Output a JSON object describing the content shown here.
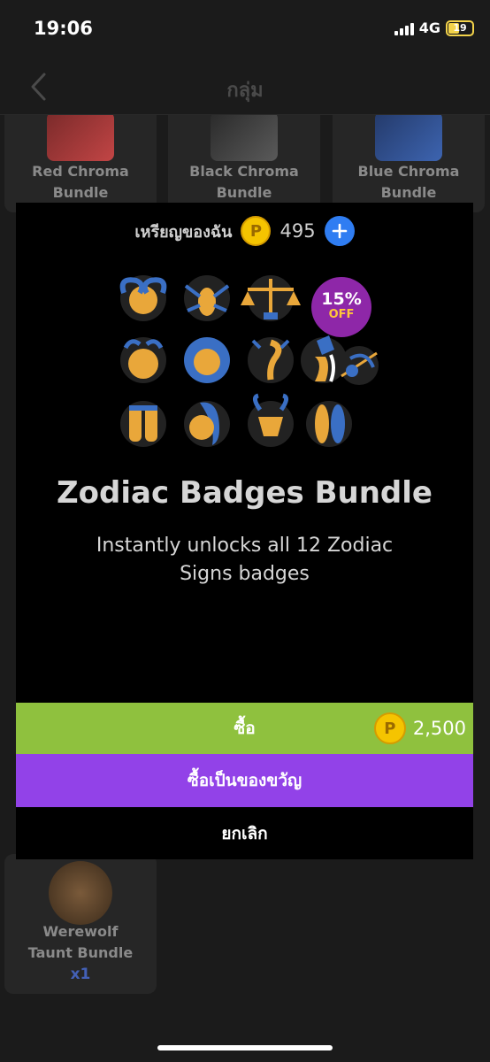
{
  "status": {
    "time": "19:06",
    "network": "4G",
    "battery": "19"
  },
  "nav": {
    "title": "กลุ่ม"
  },
  "grid": {
    "top_items": [
      {
        "name_line1": "Red Chroma",
        "name_line2": "Bundle"
      },
      {
        "name_line1": "Black Chroma",
        "name_line2": "Bundle"
      },
      {
        "name_line1": "Blue Chroma",
        "name_line2": "Bundle"
      }
    ],
    "bottom_item": {
      "name_line1": "Werewolf",
      "name_line2": "Taunt Bundle",
      "qty": "x1"
    }
  },
  "wallet": {
    "label": "เหรียญของฉัน",
    "value": "495"
  },
  "product": {
    "title": "Zodiac Badges Bundle",
    "description": "Instantly unlocks all 12 Zodiac Signs badges",
    "discount_pct": "15%",
    "discount_label": "OFF"
  },
  "actions": {
    "buy_label": "ซื้อ",
    "buy_price": "2,500",
    "gift_label": "ซื้อเป็นของขวัญ",
    "cancel_label": "ยกเลิก"
  },
  "colors": {
    "buy": "#8fc13e",
    "gift": "#9242e8",
    "coin": "#f5c400",
    "badge_blue": "#3a6fc4",
    "badge_orange": "#e9a73a"
  }
}
